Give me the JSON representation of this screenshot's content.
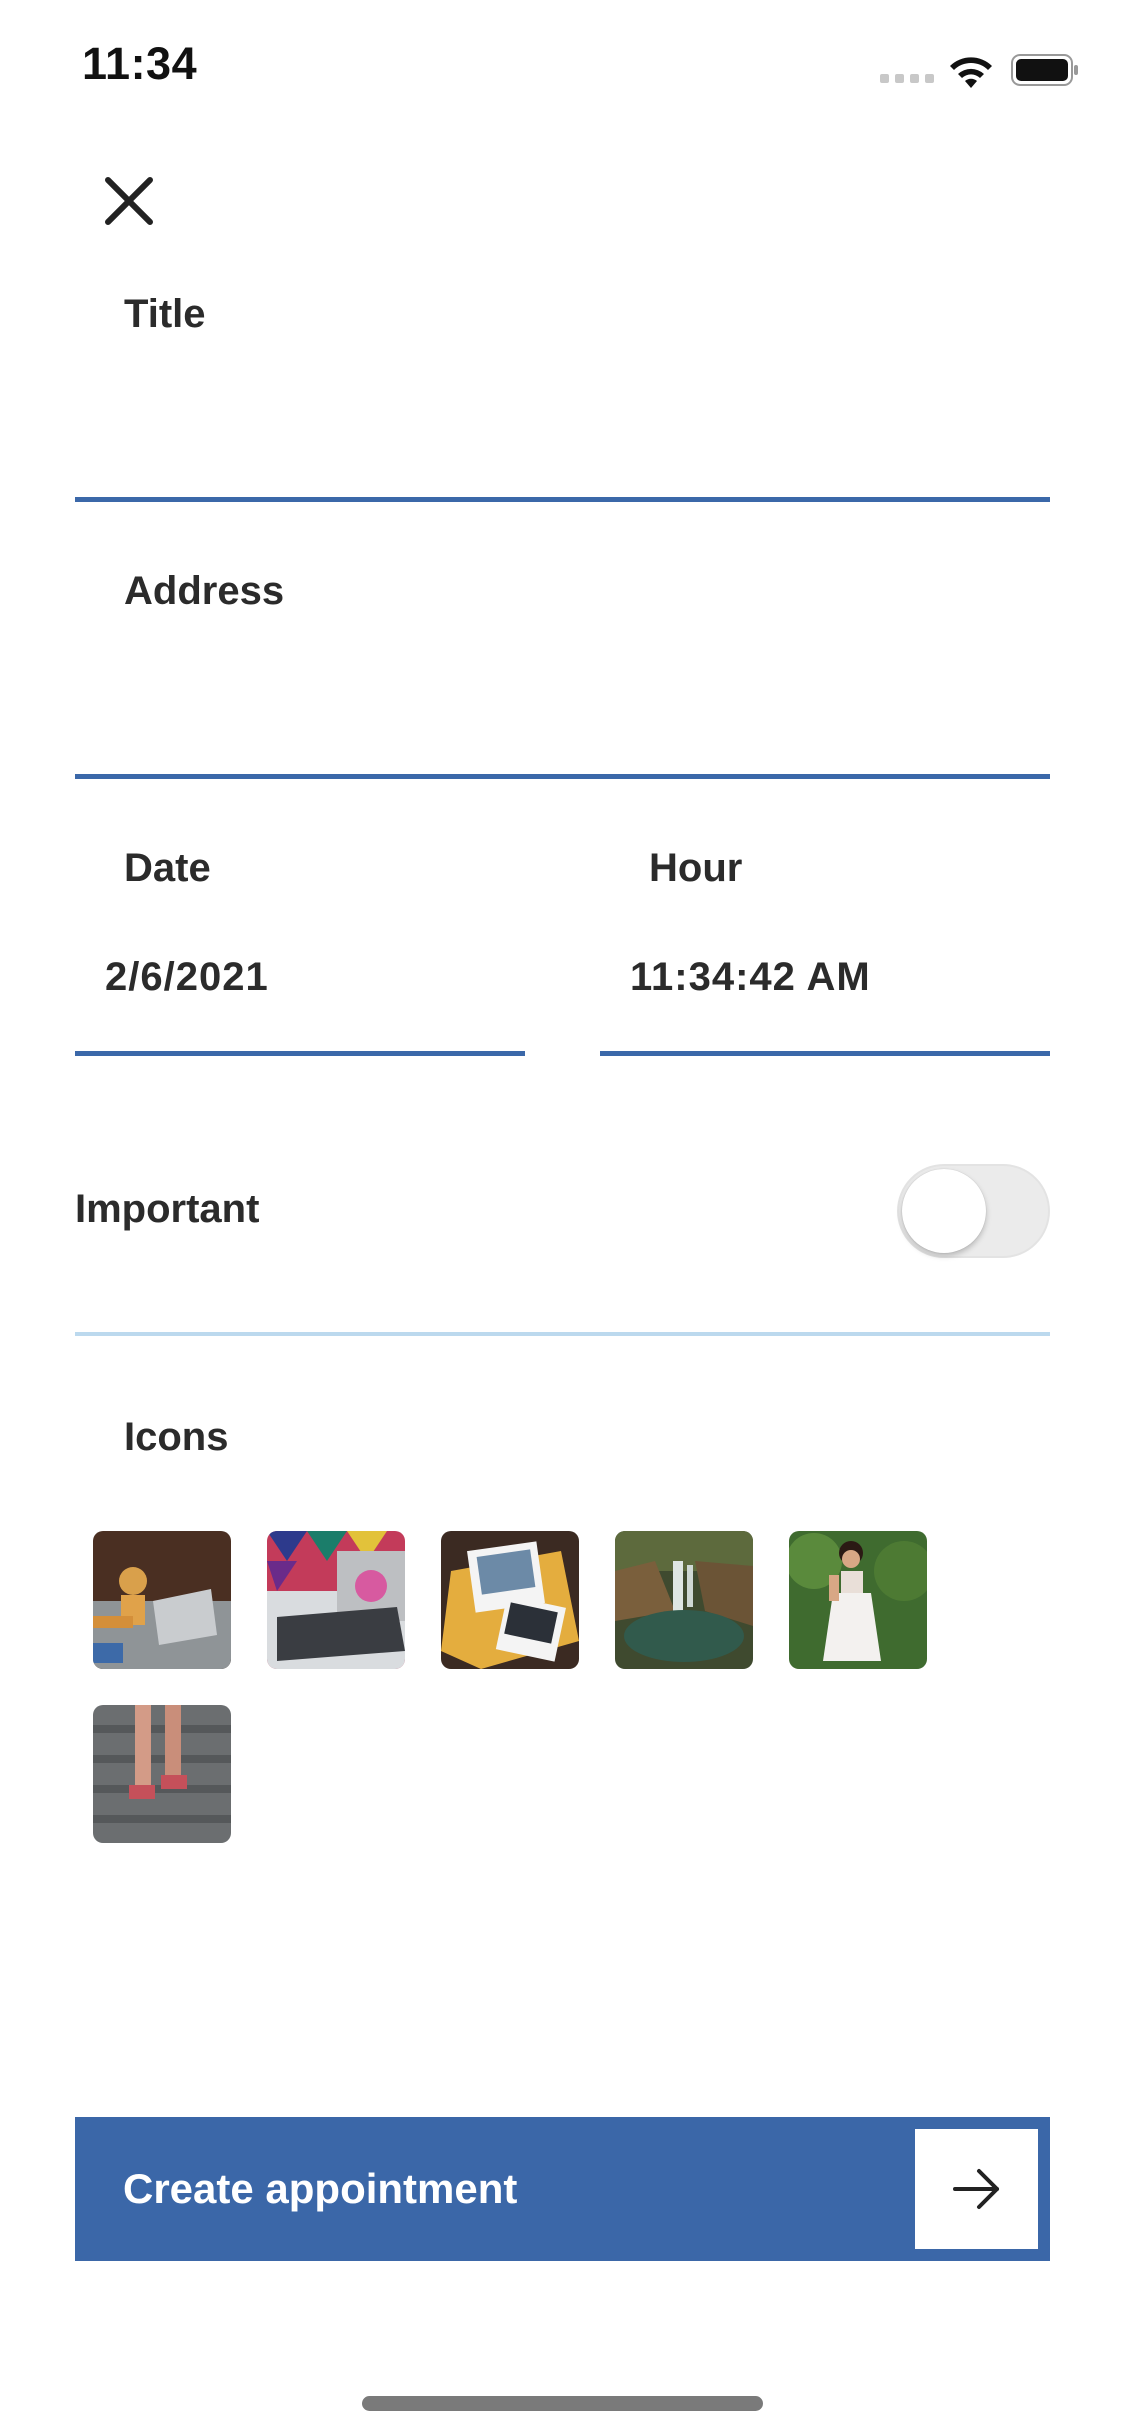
{
  "status_bar": {
    "time": "11:34"
  },
  "form": {
    "title_label": "Title",
    "title_value": "",
    "address_label": "Address",
    "address_value": "",
    "date_label": "Date",
    "date_value": "2/6/2021",
    "hour_label": "Hour",
    "hour_value": "11:34:42 AM",
    "important_label": "Important",
    "important_on": false,
    "icons_label": "Icons",
    "icons": [
      {
        "name": "robot-laptop-thumbnail"
      },
      {
        "name": "laptop-colorful-thumbnail"
      },
      {
        "name": "polaroid-photos-thumbnail"
      },
      {
        "name": "waterfall-thumbnail"
      },
      {
        "name": "woman-white-dress-thumbnail"
      },
      {
        "name": "legs-stairs-thumbnail"
      }
    ]
  },
  "cta": {
    "label": "Create appointment",
    "icon": "arrow-right-icon"
  },
  "colors": {
    "accent": "#3b67a8",
    "divider_light": "#bcd9ee",
    "text": "#2b2b2b"
  }
}
